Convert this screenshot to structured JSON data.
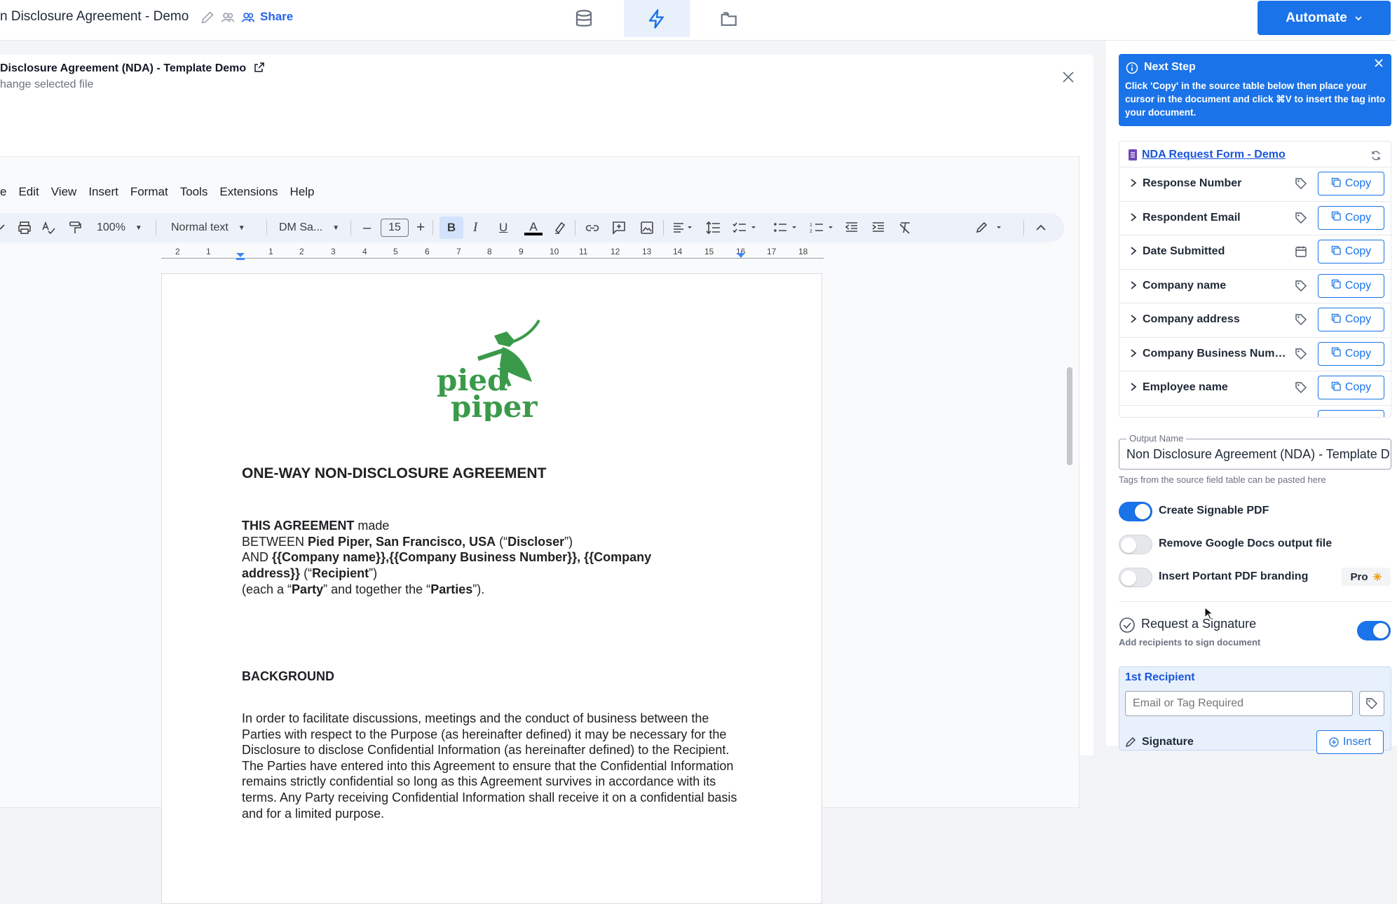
{
  "header": {
    "doc_title": "n Disclosure Agreement - Demo",
    "share_label": "Share",
    "automate_label": "Automate",
    "nav_tabs": [
      {
        "name": "database-icon",
        "active": false
      },
      {
        "name": "bolt-icon",
        "active": true
      },
      {
        "name": "folder-icon",
        "active": false
      }
    ]
  },
  "doc_card": {
    "template_title": "Disclosure Agreement (NDA) - Template Demo",
    "change_file": "hange selected file"
  },
  "gdoc": {
    "menu": [
      "e",
      "Edit",
      "View",
      "Insert",
      "Format",
      "Tools",
      "Extensions",
      "Help"
    ],
    "zoom": "100%",
    "style": "Normal text",
    "font": "DM Sa...",
    "font_size": "15",
    "ruler_ticks": [
      "2",
      "1",
      "",
      "1",
      "2",
      "3",
      "4",
      "5",
      "6",
      "7",
      "8",
      "9",
      "10",
      "11",
      "12",
      "13",
      "14",
      "15",
      "16",
      "17",
      "18"
    ]
  },
  "paper": {
    "logo_line1": "pied",
    "logo_line2": "piper",
    "heading": "ONE-WAY NON-DISCLOSURE AGREEMENT",
    "p1_bold": "THIS AGREEMENT",
    "p1_rest": " made",
    "p2_a": "BETWEEN ",
    "p2_bold": "Pied Piper, San Francisco, USA",
    "p2_b": " (“",
    "p2_bold2": "Discloser",
    "p2_c": "”)",
    "p3_a": "AND ",
    "p3_bold": "{{Company name}},{{Company Business Number}}, {{Company",
    "p4_bold": "address}}",
    "p4_a": " (“",
    "p4_bold2": "Recipient",
    "p4_b": "”)",
    "p5_a": "(each a “",
    "p5_bold": "Party",
    "p5_b": "” and together the “",
    "p5_bold2": "Parties",
    "p5_c": "”).",
    "background_heading": "BACKGROUND",
    "body": "In order to facilitate discussions, meetings and the conduct of business between the Parties with respect to the Purpose (as hereinafter defined) it may be necessary for the Disclosure to disclose Confidential Information (as hereinafter defined) to the Recipient. The Parties have entered into this Agreement to ensure that the Confidential Information remains strictly confidential so long as this Agreement survives in accordance with its terms. Any Party receiving Confidential Information shall receive it on a confidential basis and for a limited purpose."
  },
  "panel": {
    "next_step_title": "Next Step",
    "next_step_text": "Click 'Copy' in the source table below then place your cursor in the document and click ⌘V to insert the tag into your document.",
    "form_link": "NDA Request Form - Demo",
    "copy_label": "Copy",
    "fields": [
      {
        "label": "Response Number",
        "type": "tag-icon"
      },
      {
        "label": "Respondent Email",
        "type": "tag-icon"
      },
      {
        "label": "Date Submitted",
        "type": "calendar-icon"
      },
      {
        "label": "Company name",
        "type": "tag-icon"
      },
      {
        "label": "Company address",
        "type": "tag-icon"
      },
      {
        "label": "Company Business Number",
        "type": "tag-icon"
      },
      {
        "label": "Employee name",
        "type": "tag-icon"
      }
    ],
    "output_label": "Output Name",
    "output_value": "Non Disclosure Agreement (NDA) - Template Demo",
    "output_help": "Tags from the source field table can be pasted here",
    "toggles": [
      {
        "label": "Create Signable PDF",
        "on": true
      },
      {
        "label": "Remove Google Docs output file",
        "on": false
      },
      {
        "label": "Insert Portant PDF branding",
        "on": false
      }
    ],
    "pro_label": "Pro",
    "signature_title": "Request a Signature",
    "signature_sub": "Add recipients to sign document",
    "recipient_title": "1st Recipient",
    "recipient_placeholder": "Email or Tag Required",
    "signature_label": "Signature",
    "insert_label": "Insert"
  },
  "colors": {
    "accent": "#1a73e8",
    "logo_green": "#3a9a4a"
  }
}
